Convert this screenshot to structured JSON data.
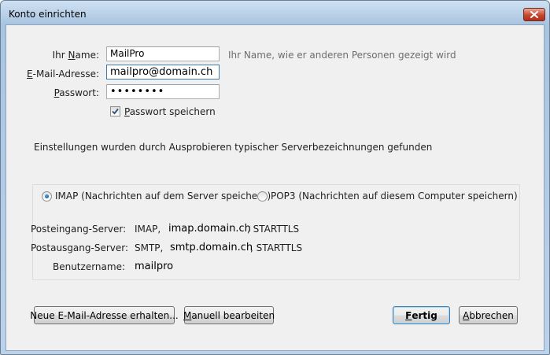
{
  "window": {
    "title": "Konto einrichten"
  },
  "form": {
    "name": {
      "label_u": "N",
      "label_pre": "Ihr ",
      "label_post": "ame:",
      "value": "MailPro",
      "hint": "Ihr Name, wie er anderen Personen gezeigt wird"
    },
    "email": {
      "label_u": "E",
      "label_post": "-Mail-Adresse:",
      "value": "mailpro@domain.ch"
    },
    "password": {
      "label_u": "P",
      "label_post": "asswort:",
      "value": "••••••••"
    },
    "save_password": {
      "label_u": "P",
      "label_post": "asswort speichern",
      "checked": true
    }
  },
  "status": "Einstellungen wurden durch Ausprobieren typischer Serverbezeichnungen gefunden",
  "protocol": {
    "imap": "IMAP (Nachrichten auf dem Server speichern)",
    "pop3": "POP3 (Nachrichten auf diesem Computer speichern)",
    "selected": "IMAP"
  },
  "servers": {
    "incoming": {
      "label": "Posteingang-Server:",
      "type": "IMAP,",
      "host": "imap.domain.ch",
      "security": ", STARTTLS"
    },
    "outgoing": {
      "label": "Postausgang-Server:",
      "type": "SMTP,",
      "host": "smtp.domain.ch",
      "security": ", STARTTLS"
    },
    "username": {
      "label": "Benutzername:",
      "value": "mailpro"
    }
  },
  "buttons": {
    "new_address": "Neue E-Mail-Adresse erhalten...",
    "manual_u": "M",
    "manual_post": "anuell bearbeiten",
    "done_u": "F",
    "done_post": "ertig",
    "cancel_u": "A",
    "cancel_post": "bbrechen"
  },
  "colors": {
    "accent": "#3c7fb1",
    "close": "#c9452e"
  }
}
